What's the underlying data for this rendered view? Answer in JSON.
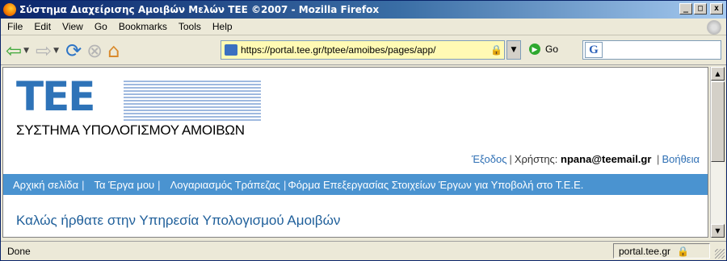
{
  "window": {
    "title": "Σύστημα Διαχείρισης Αμοιβών Μελών ΤΕΕ ©2007 - Mozilla Firefox",
    "minimize": "_",
    "maximize": "□",
    "close": "x"
  },
  "menu": {
    "items": [
      {
        "label": "File"
      },
      {
        "label": "Edit"
      },
      {
        "label": "View"
      },
      {
        "label": "Go"
      },
      {
        "label": "Bookmarks"
      },
      {
        "label": "Tools"
      },
      {
        "label": "Help"
      }
    ]
  },
  "toolbar": {
    "url": "https://portal.tee.gr/tptee/amoibes/pages/app/",
    "go_label": "Go",
    "search_value": "",
    "search_engine_letter": "G"
  },
  "page": {
    "logo_text": "TEE",
    "system_name": "ΣΥΣΤΗΜΑ ΥΠΟΛΟΓΙΣΜΟΥ ΑΜΟΙΒΩΝ",
    "logout_link": "Έξοδος",
    "user_label": "Χρήστης:",
    "username": "npana@teemail.gr",
    "help_link": "Βοήθεια",
    "nav": [
      {
        "label": "Αρχική σελίδα"
      },
      {
        "label": "Τα Έργα μου"
      },
      {
        "label": "Λογαριασμός Τράπεζας"
      },
      {
        "label": "Φόρμα Επεξεργασίας Στοιχείων Έργων για Υποβολή στο Τ.Ε.Ε."
      }
    ],
    "welcome": "Καλώς ήρθατε στην Υπηρεσία Υπολογισμού Αμοιβών"
  },
  "status": {
    "text": "Done",
    "domain": "portal.tee.gr"
  },
  "colors": {
    "titlebar": "#0a246a",
    "nav_strip": "#4a93d0",
    "logo_blue": "#2e73b8",
    "link": "#2e6fb4",
    "welcome_text": "#1f5f9a",
    "url_secure_bg": "#fffab4"
  }
}
